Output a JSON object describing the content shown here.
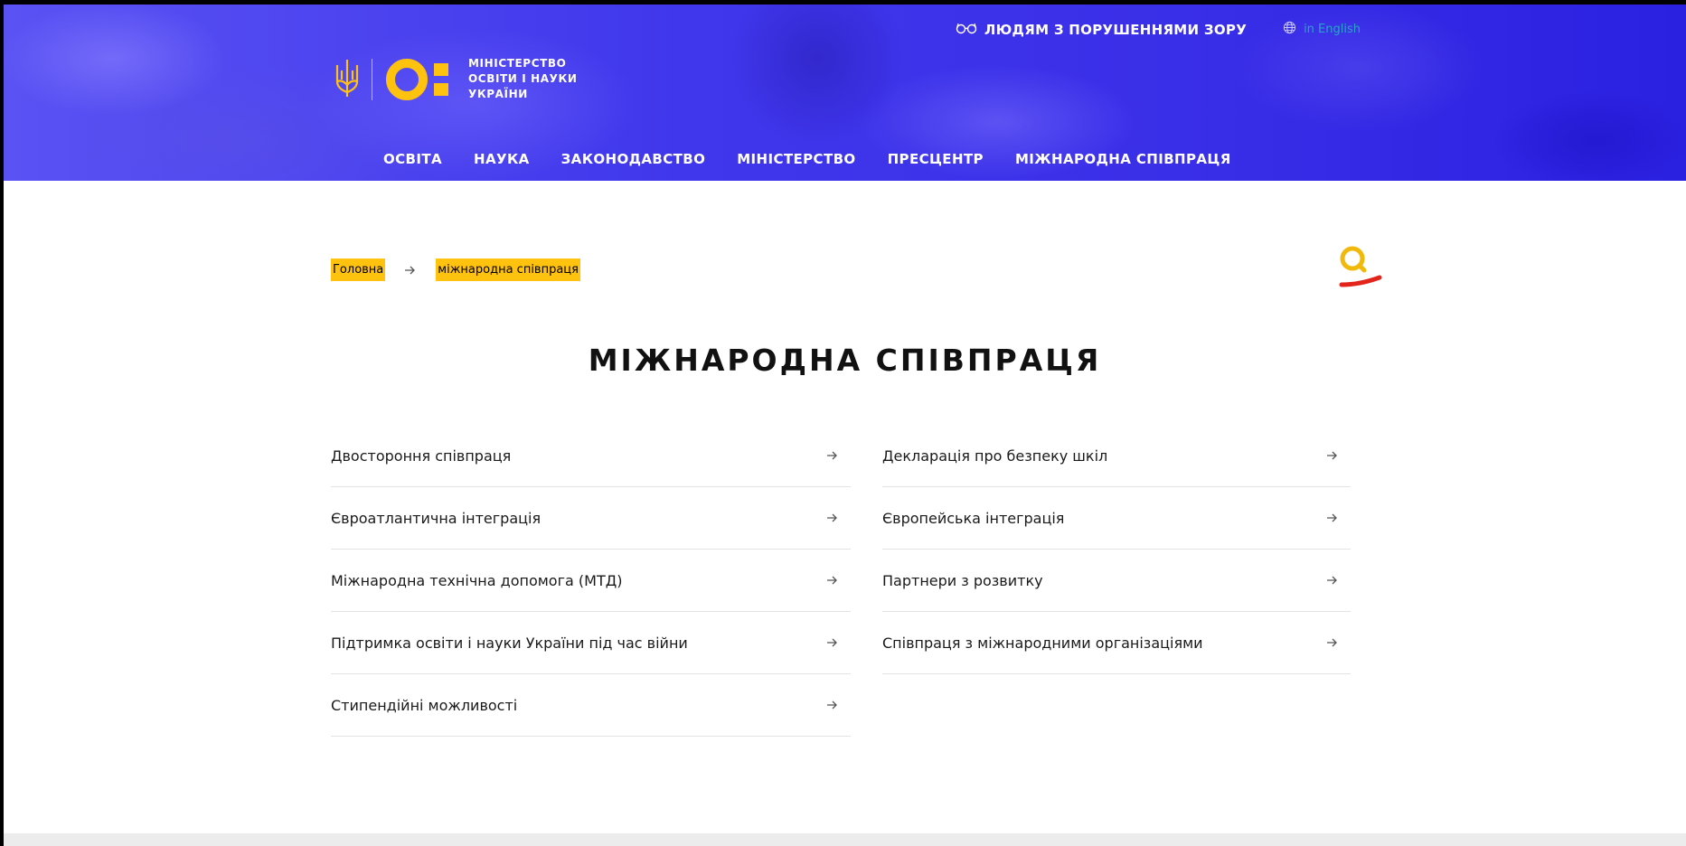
{
  "header": {
    "vision_link": "ЛЮДЯМ З ПОРУШЕННЯМИ ЗОРУ",
    "lang_link": "in English",
    "logo_lines": [
      "МІНІСТЕРСТВО",
      "ОСВІТИ І НАУКИ",
      "УКРАЇНИ"
    ],
    "nav": [
      "ОСВІТА",
      "НАУКА",
      "ЗАКОНОДАВСТВО",
      "МІНІСТЕРСТВО",
      "ПРЕСЦЕНТР",
      "МІЖНАРОДНА СПІВПРАЦЯ"
    ]
  },
  "breadcrumb": {
    "home": "Головна",
    "current": "міжнародна співпраця"
  },
  "page": {
    "title": "МІЖНАРОДНА СПІВПРАЦЯ"
  },
  "left_items": [
    "Двостороння співпраця",
    "Євроатлантична інтеграція",
    "Міжнародна технічна допомога (МТД)",
    "Підтримка освіти і науки України під час війни",
    "Стипендійні можливості"
  ],
  "right_items": [
    "Декларація про безпеку шкіл",
    "Європейська інтеграція",
    "Партнери з розвитку",
    "Співпраця з міжнародними організаціями"
  ],
  "colors": {
    "brand_blue": "#4b3df0",
    "accent_yellow": "#ffc20e",
    "accent_red": "#e3241b"
  },
  "icons": {
    "vision": "glasses-icon",
    "lang": "globe-icon",
    "search": "search-icon",
    "arrow": "arrow-right-icon",
    "trident": "trident-icon"
  }
}
